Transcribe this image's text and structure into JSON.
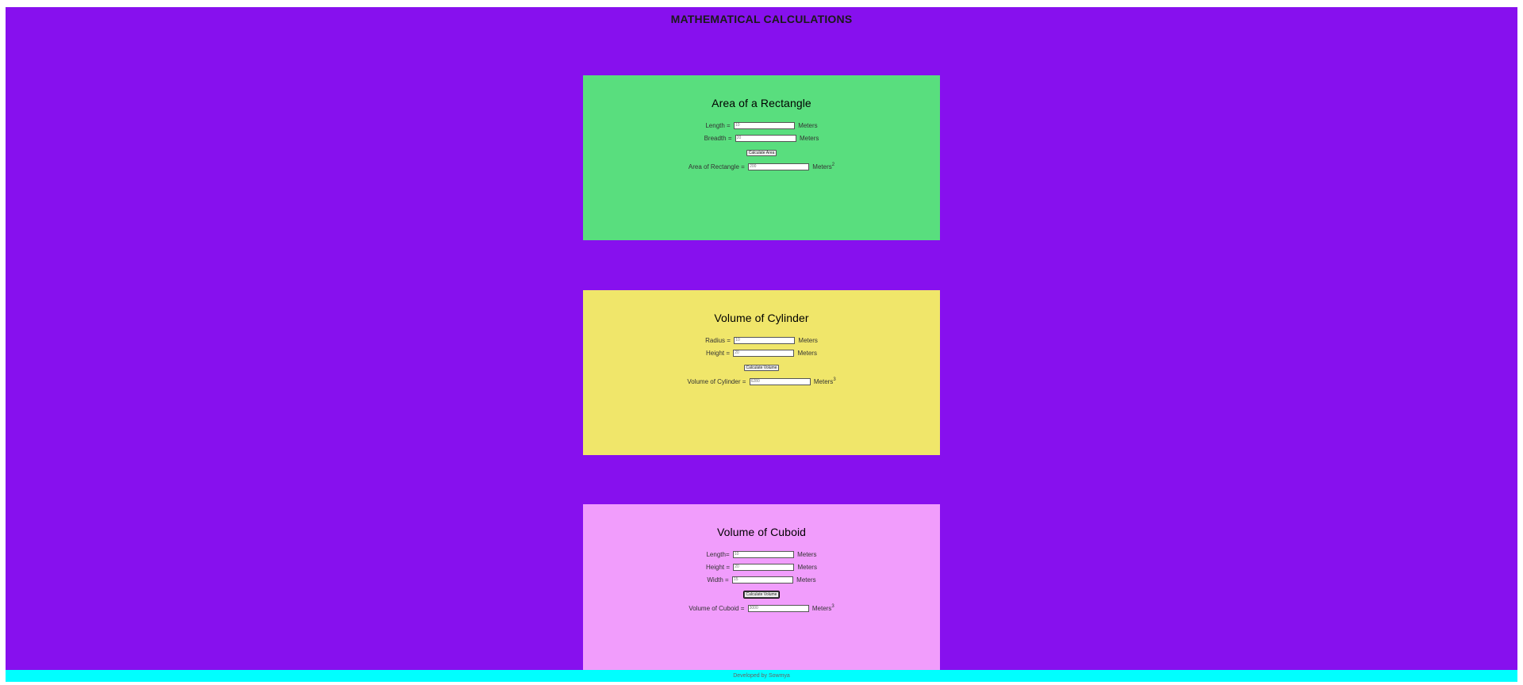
{
  "header": {
    "title": "MATHEMATICAL CALCULATIONS"
  },
  "colors": {
    "page_bg": "#8710ee",
    "rectangle_card": "#59de7e",
    "cylinder_card": "#f0e66a",
    "cuboid_card": "#f19dfc",
    "footer_bg": "#00ffff"
  },
  "rectangle": {
    "title": "Area of a Rectangle",
    "length_label": "Length =",
    "length_value": "10",
    "breadth_label": "Breadth =",
    "breadth_value": "20",
    "unit": "Meters",
    "button": "Calculate Area",
    "result_label": "Area of Rectangle =",
    "result_value": "200",
    "result_unit": "Meters",
    "result_exp": "2"
  },
  "cylinder": {
    "title": "Volume of Cylinder",
    "radius_label": "Radius =",
    "radius_value": "10",
    "height_label": "Height =",
    "height_value": "20",
    "unit": "Meters",
    "button": "Calculate Volume",
    "result_label": "Volume of Cylinder =",
    "result_value": "6280",
    "result_unit": "Meters",
    "result_exp": "3"
  },
  "cuboid": {
    "title": "Volume of Cuboid",
    "length_label": "Length=",
    "length_value": "10",
    "height_label": "Height =",
    "height_value": "20",
    "width_label": "Width =",
    "width_value": "15",
    "unit": "Meters",
    "button": "Calculate Volume",
    "result_label": "Volume of Cuboid =",
    "result_value": "3000",
    "result_unit": "Meters",
    "result_exp": "3"
  },
  "footer": {
    "text": "Developed by Sowmya"
  }
}
